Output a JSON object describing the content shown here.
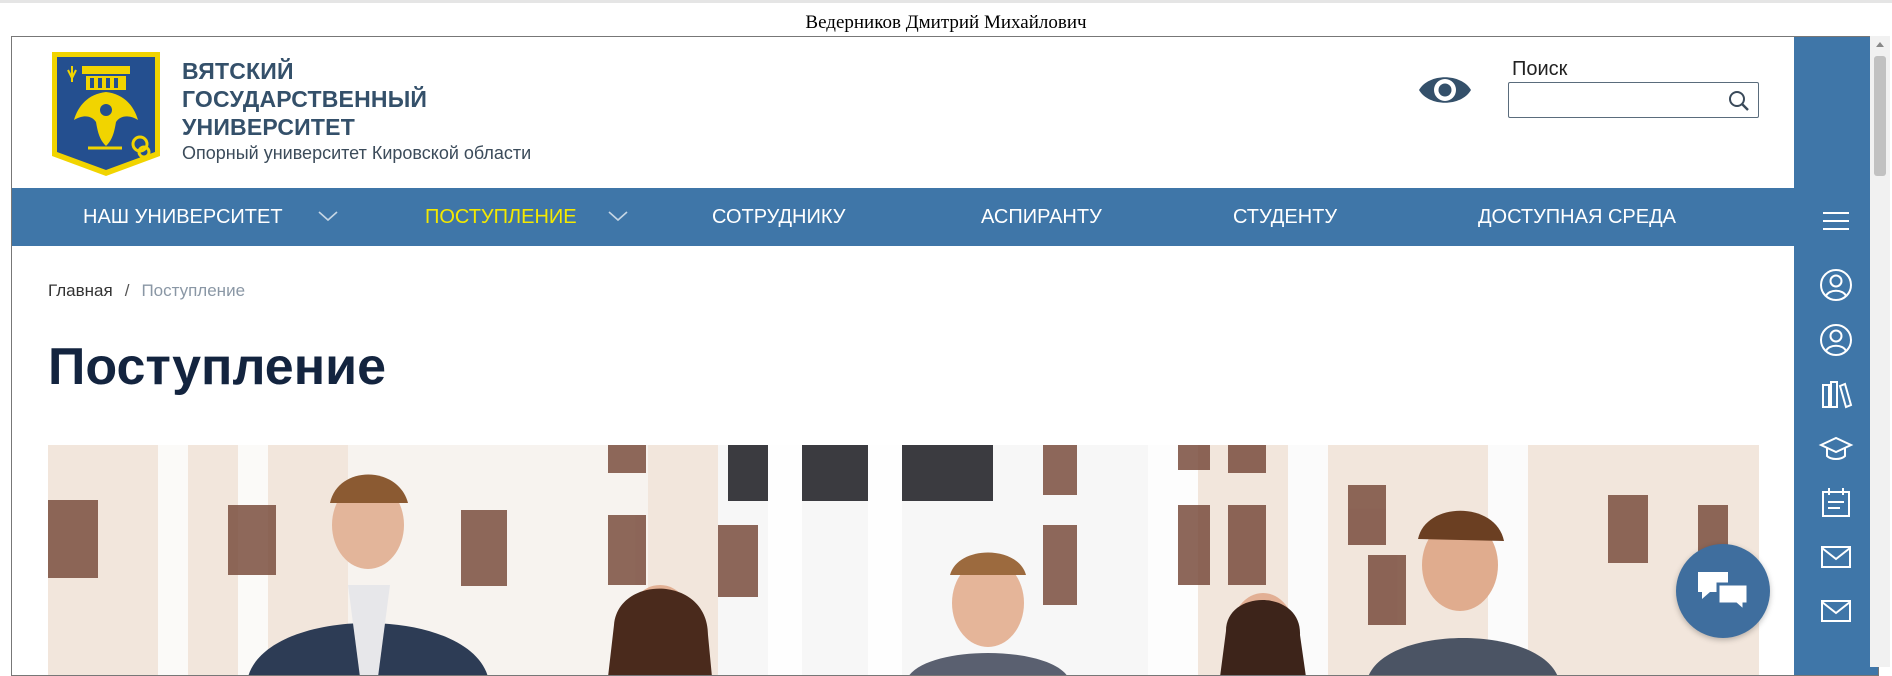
{
  "user": {
    "full_name": "Ведерников Дмитрий Михайлович"
  },
  "header": {
    "university_name_lines": [
      "ВЯТСКИЙ",
      "ГОСУДАРСТВЕННЫЙ",
      "УНИВЕРСИТЕТ"
    ],
    "subtitle": "Опорный университет Кировской области",
    "search": {
      "label": "Поиск",
      "value": "",
      "placeholder": ""
    }
  },
  "nav": {
    "items": [
      {
        "label": "НАШ УНИВЕРСИТЕТ",
        "has_dropdown": true,
        "active": false
      },
      {
        "label": "ПОСТУПЛЕНИЕ",
        "has_dropdown": true,
        "active": true
      },
      {
        "label": "СОТРУДНИКУ",
        "has_dropdown": false,
        "active": false
      },
      {
        "label": "АСПИРАНТУ",
        "has_dropdown": false,
        "active": false
      },
      {
        "label": "СТУДЕНТУ",
        "has_dropdown": false,
        "active": false
      },
      {
        "label": "ДОСТУПНАЯ СРЕДА",
        "has_dropdown": false,
        "active": false
      }
    ]
  },
  "breadcrumb": {
    "home": "Главная",
    "separator": "/",
    "current": "Поступление"
  },
  "page": {
    "title": "Поступление"
  },
  "sidebar": {
    "icons": [
      "menu-icon",
      "user-circle-icon",
      "user-circle-icon",
      "books-icon",
      "graduation-cap-icon",
      "calendar-list-icon",
      "mail-icon",
      "mail-icon"
    ]
  },
  "colors": {
    "nav_bg": "#3f76a8",
    "nav_active_text": "#f4e900",
    "title_text": "#13243f",
    "sidebar_bg": "#3f76a8",
    "logo_shield": "#244f8f",
    "logo_gold": "#f1d400"
  }
}
